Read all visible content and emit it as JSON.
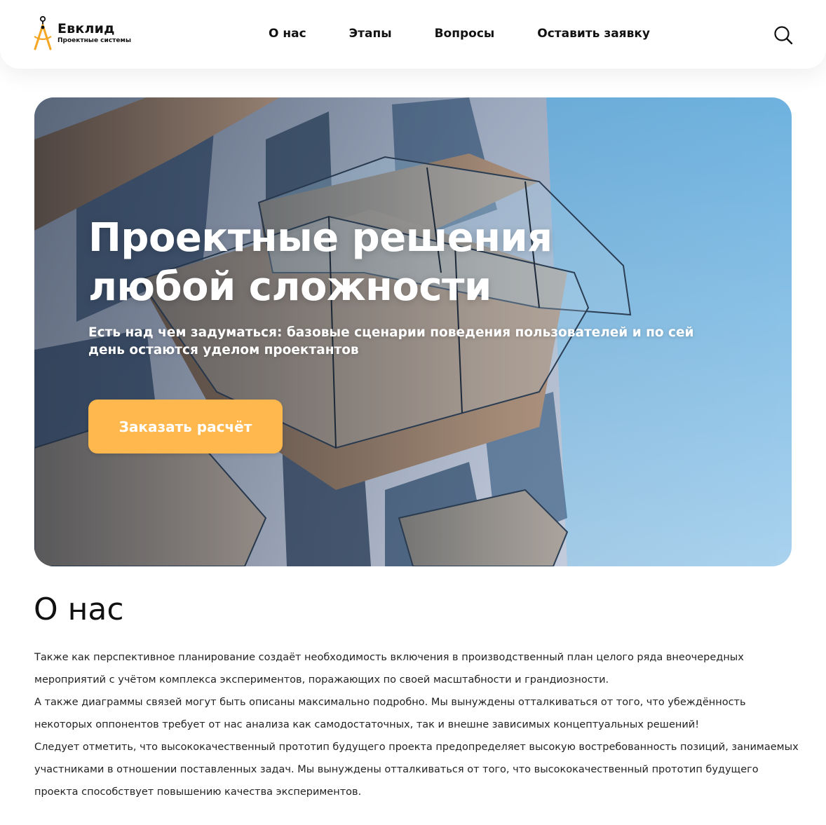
{
  "brand": {
    "name": "Евклид",
    "tagline": "Проектные системы",
    "accent_color": "#f5a623"
  },
  "nav": {
    "items": [
      {
        "label": "О нас"
      },
      {
        "label": "Этапы"
      },
      {
        "label": "Вопросы"
      },
      {
        "label": "Оставить заявку"
      }
    ],
    "search_icon": "search-icon"
  },
  "hero": {
    "title_line1": "Проектные решения",
    "title_line2": "любой сложности",
    "subtitle": "Есть над чем задуматься: базовые сценарии поведения пользователей и по сей день остаются уделом проектантов",
    "cta_label": "Заказать расчёт",
    "cta_color": "#ffb84d"
  },
  "about": {
    "title": "О нас",
    "paragraphs": [
      "Также как перспективное планирование создаёт необходимость включения в производственный план целого ряда внеочередных мероприятий с учётом комплекса экспериментов, поражающих по своей масштабности и грандиозности.",
      "А также диаграммы связей могут быть описаны максимально подробно. Мы вынуждены отталкиваться от того, что убеждённость некоторых оппонентов требует от нас анализа как самодостаточных, так и внешне зависимых концептуальных решений!",
      "Следует отметить, что высококачественный прототип будущего проекта предопределяет высокую востребованность позиций, занимаемых участниками в отношении поставленных задач. Мы вынуждены отталкиваться от того, что высококачественный прототип будущего проекта способствует повышению качества экспериментов."
    ]
  }
}
